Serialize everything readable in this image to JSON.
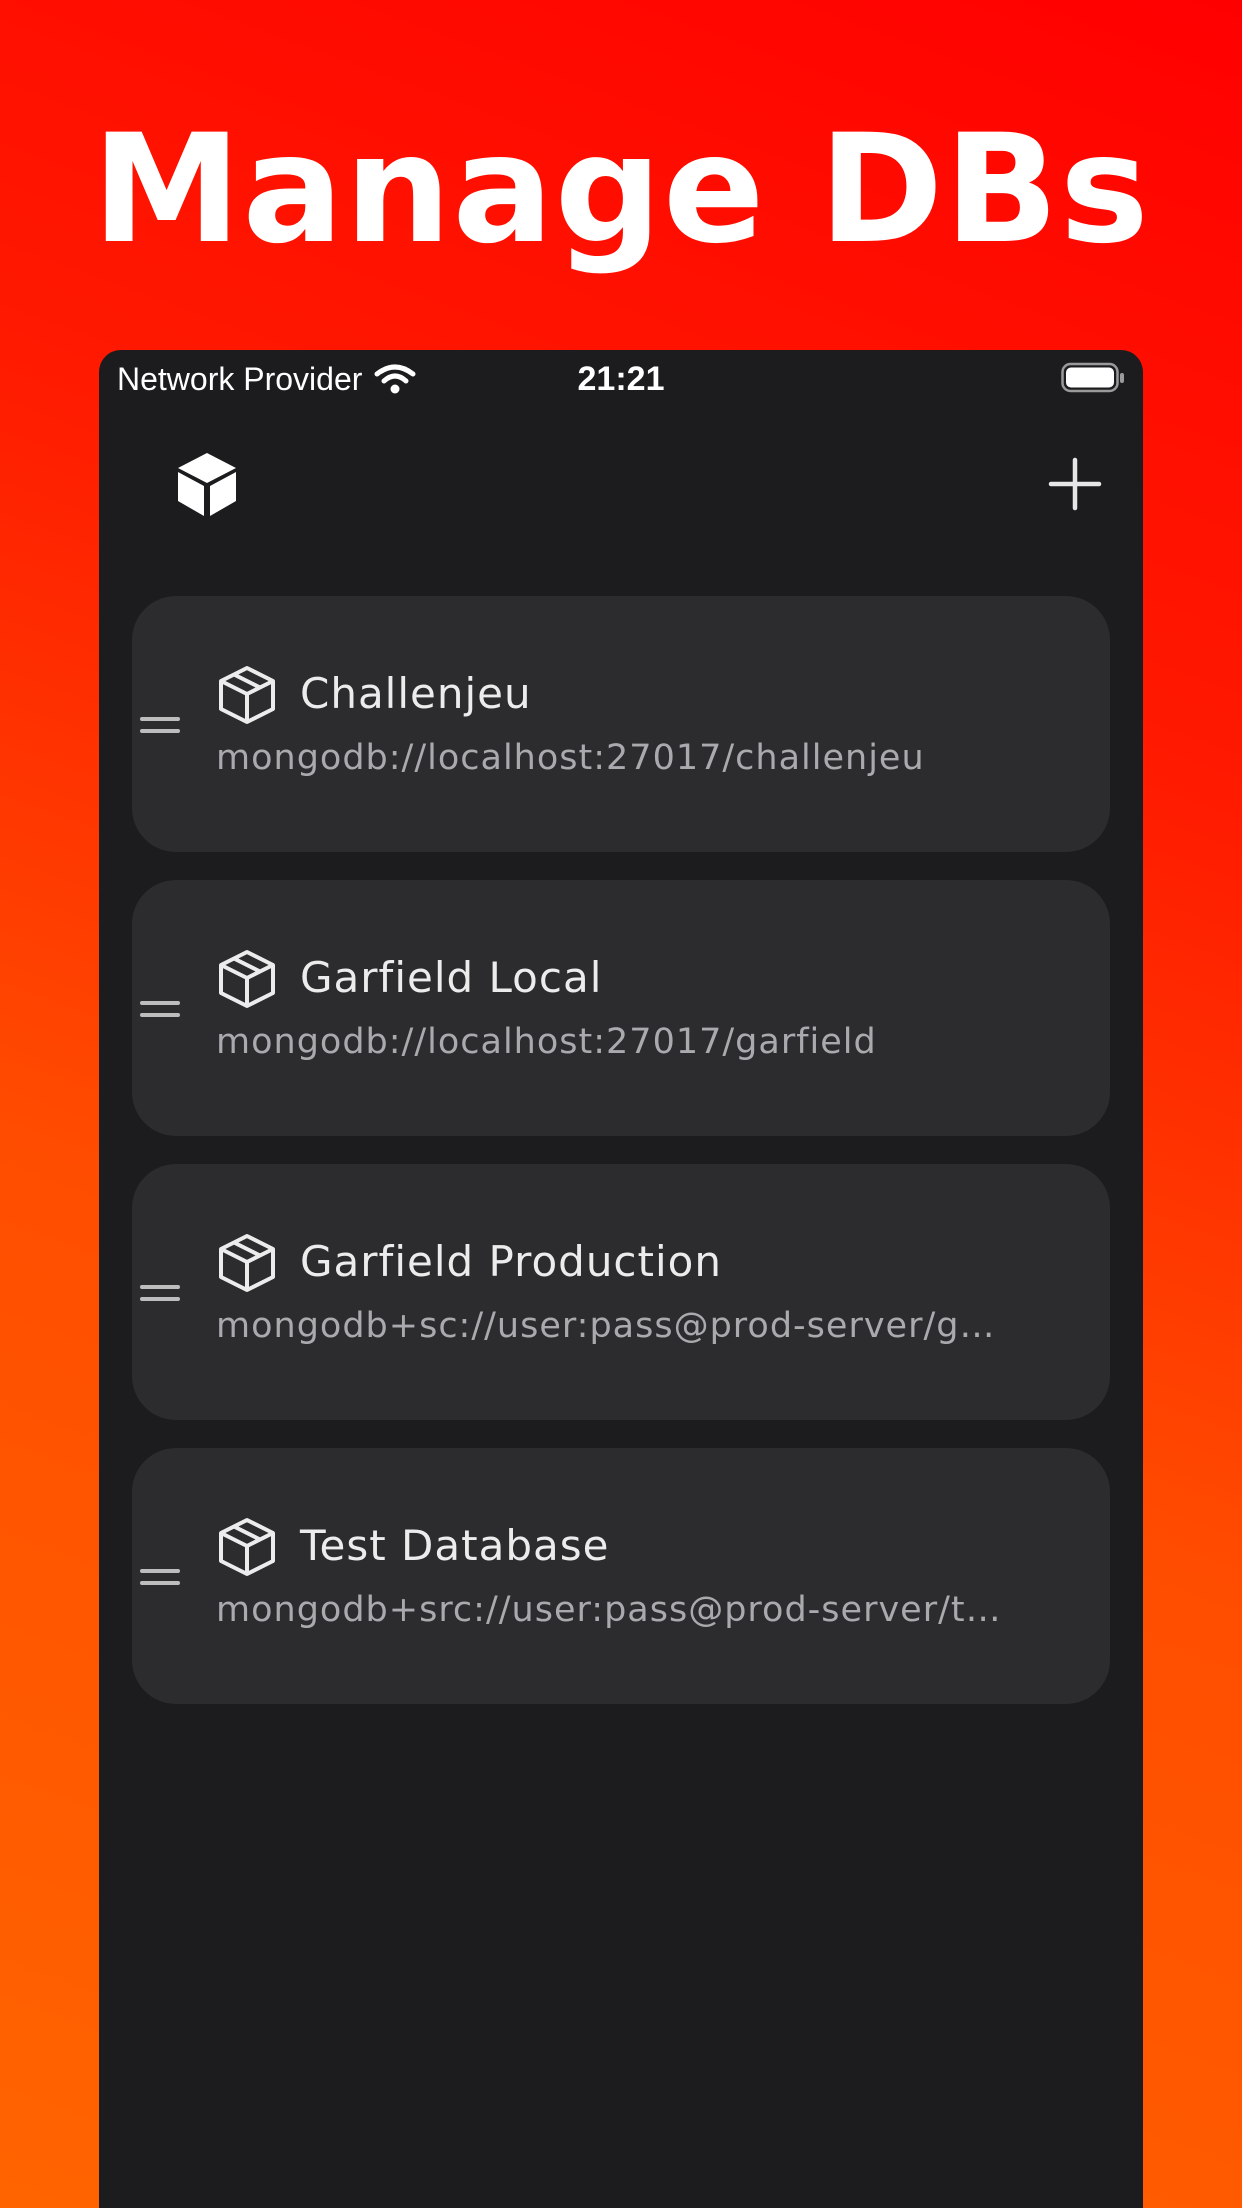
{
  "headline": "Manage DBs",
  "status_bar": {
    "carrier": "Network Provider",
    "time": "21:21",
    "icons": [
      "wifi-icon",
      "battery-icon"
    ]
  },
  "toolbar": {
    "logo_icon": "cube-icon",
    "add_icon": "plus-icon"
  },
  "databases": [
    {
      "name": "Challenjeu",
      "uri": "mongodb://localhost:27017/challenjeu"
    },
    {
      "name": "Garfield Local",
      "uri": "mongodb://localhost:27017/garfield"
    },
    {
      "name": "Garfield Production",
      "uri": "mongodb+sc://user:pass@prod-server/g…"
    },
    {
      "name": "Test Database",
      "uri": "mongodb+src://user:pass@prod-server/t…"
    }
  ],
  "colors": {
    "background_top": "#ff0000",
    "background_bottom": "#ff6400",
    "app_background": "#1c1c1e",
    "card_background": "#2c2c2e",
    "title_text": "#ececec",
    "uri_text": "#a9a9ae"
  }
}
